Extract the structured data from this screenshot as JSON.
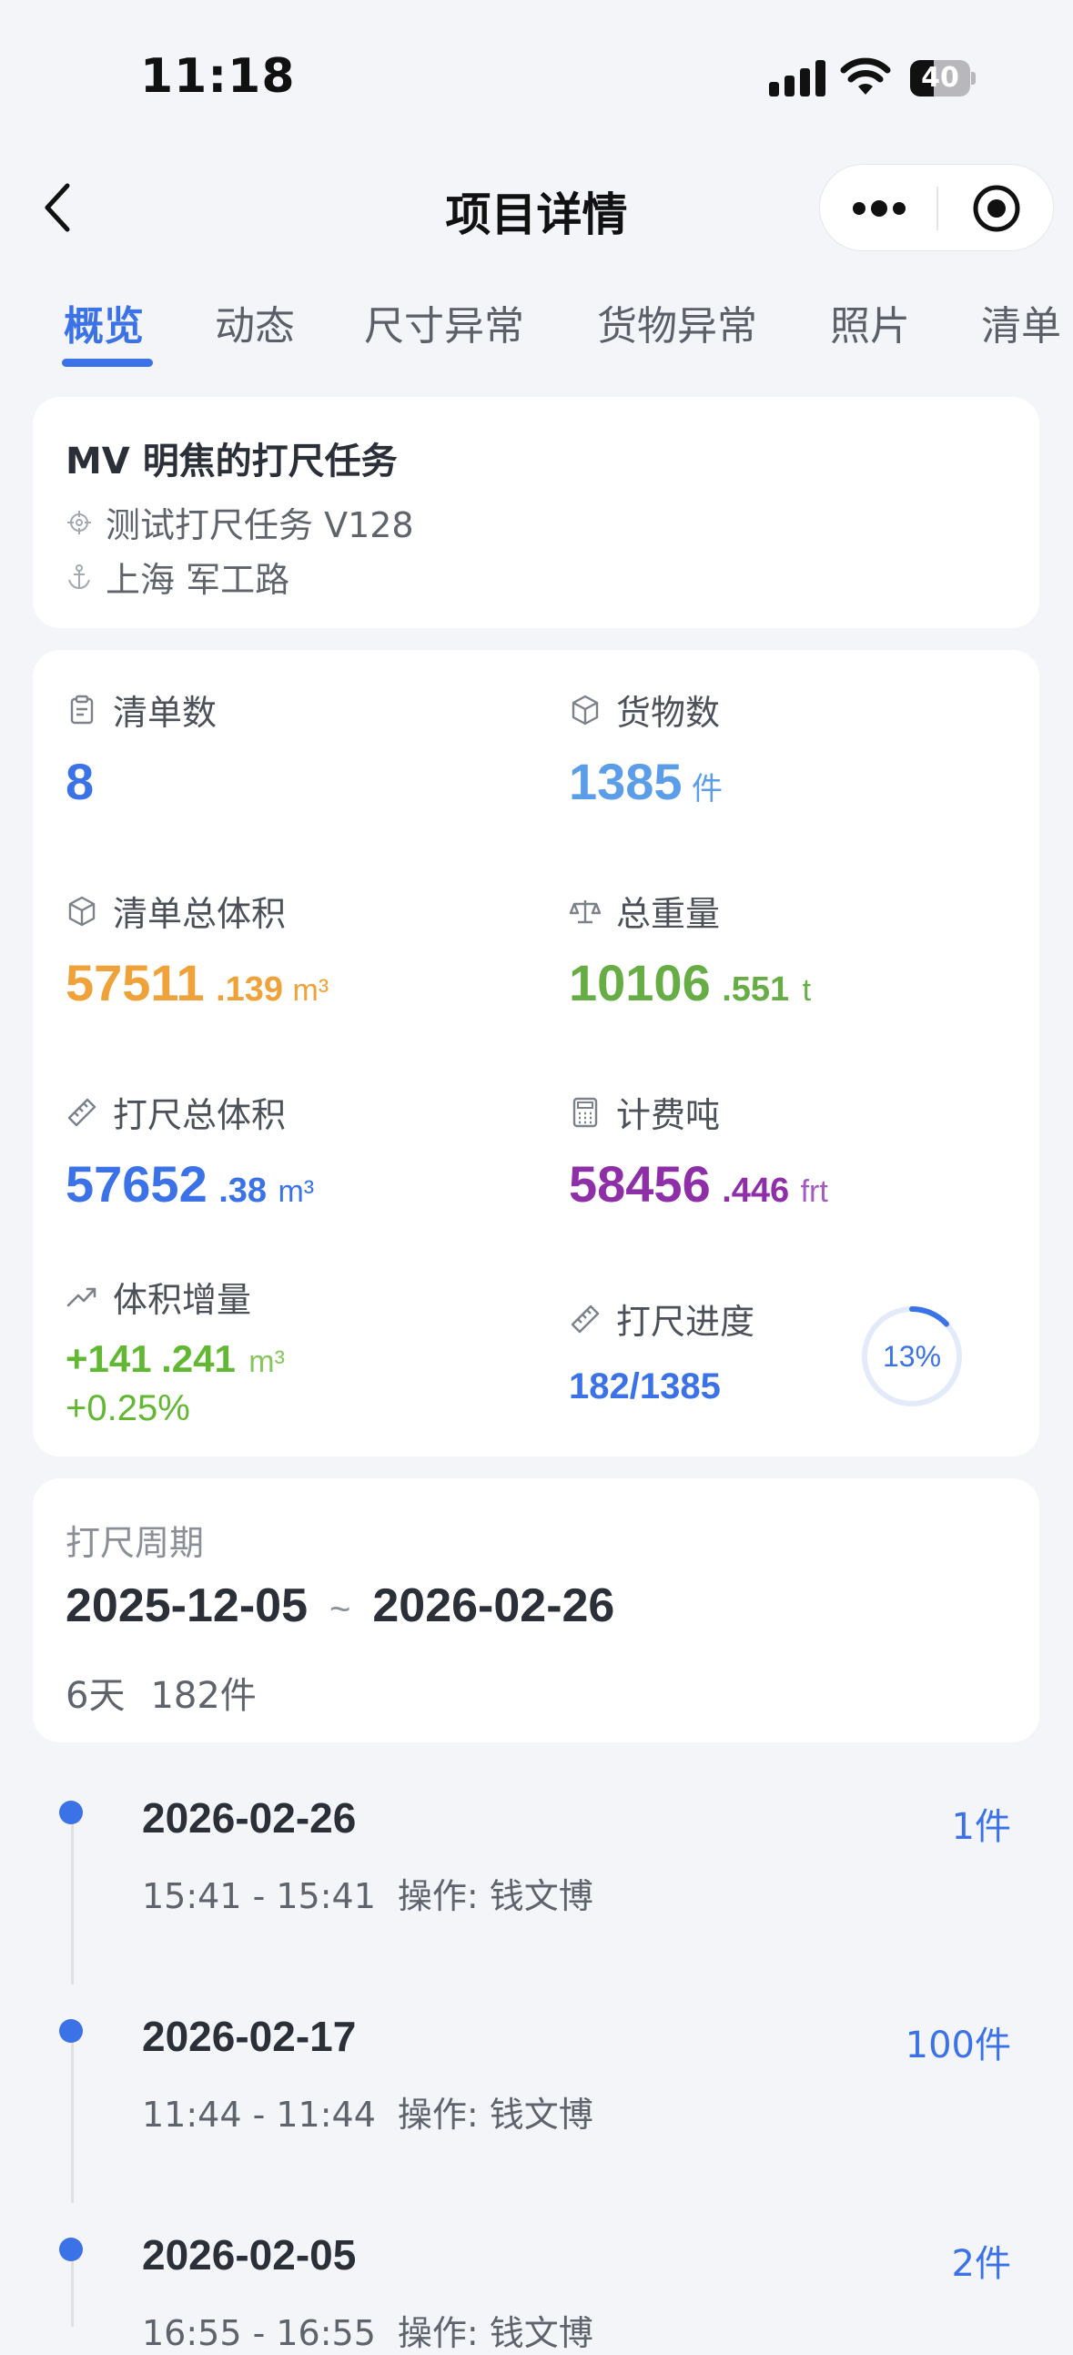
{
  "status_bar": {
    "time": "11:18",
    "battery": "40"
  },
  "nav": {
    "title": "项目详情"
  },
  "tabs": [
    {
      "label": "概览",
      "active": true
    },
    {
      "label": "动态"
    },
    {
      "label": "尺寸异常"
    },
    {
      "label": "货物异常"
    },
    {
      "label": "照片"
    },
    {
      "label": "清单"
    }
  ],
  "task": {
    "title": "MV 明焦的打尺任务",
    "subtitle": "测试打尺任务 V128",
    "location": "上海 军工路"
  },
  "stats": {
    "list_count": {
      "label": "清单数",
      "value": "8"
    },
    "cargo_count": {
      "label": "货物数",
      "value": "1385",
      "unit": "件"
    },
    "list_volume": {
      "label": "清单总体积",
      "int": "57511",
      "dec": ".139",
      "unit": "m³"
    },
    "total_weight": {
      "label": "总重量",
      "int": "10106",
      "dec": ".551",
      "unit": "t"
    },
    "measured_volume": {
      "label": "打尺总体积",
      "int": "57652",
      "dec": ".38",
      "unit": "m³"
    },
    "billing_ton": {
      "label": "计费吨",
      "int": "58456",
      "dec": ".446",
      "unit": "frt"
    },
    "volume_increase": {
      "label": "体积增量",
      "int": "+141",
      "dec": ".241",
      "unit": "m³",
      "percent": "+0.25%"
    },
    "progress": {
      "label": "打尺进度",
      "value": "182/1385",
      "percent_text": "13%",
      "fraction": 0.13
    }
  },
  "colors": {
    "accent": "#3b72e8",
    "orange": "#f0a23a",
    "green": "#67ad45",
    "purple": "#8e2fa8",
    "light_blue": "#5b9de8",
    "increase_green": "#62b832"
  },
  "period": {
    "label": "打尺周期",
    "start": "2025-12-05",
    "tilde": "~",
    "end": "2026-02-26",
    "days": "6天",
    "count": "182件"
  },
  "timeline": [
    {
      "date": "2026-02-26",
      "time": "15:41 - 15:41",
      "operator": "操作: 钱文博",
      "count": "1件"
    },
    {
      "date": "2026-02-17",
      "time": "11:44 - 11:44",
      "operator": "操作: 钱文博",
      "count": "100件"
    },
    {
      "date": "2026-02-05",
      "time": "16:55 - 16:55",
      "operator": "操作: 钱文博",
      "count": "2件"
    }
  ]
}
